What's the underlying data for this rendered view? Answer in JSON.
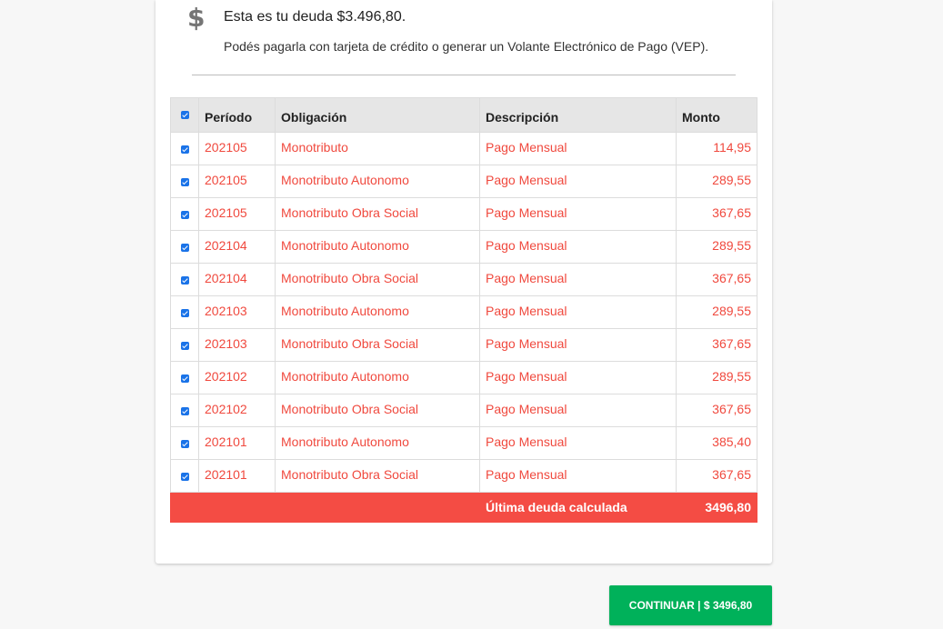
{
  "header": {
    "icon": "dollar-icon",
    "icon_glyph": "$",
    "title": "Esta es tu deuda $3.496,80.",
    "subtitle": "Podés pagarla con tarjeta de crédito o generar un Volante Electrónico de Pago (VEP)."
  },
  "table": {
    "columns": [
      "Período",
      "Obligación",
      "Descripción",
      "Monto"
    ],
    "select_all_checked": true,
    "rows": [
      {
        "checked": true,
        "period": "202105",
        "obligation": "Monotributo",
        "description": "Pago Mensual",
        "amount": "114,95"
      },
      {
        "checked": true,
        "period": "202105",
        "obligation": "Monotributo Autonomo",
        "description": "Pago Mensual",
        "amount": "289,55"
      },
      {
        "checked": true,
        "period": "202105",
        "obligation": "Monotributo Obra Social",
        "description": "Pago Mensual",
        "amount": "367,65"
      },
      {
        "checked": true,
        "period": "202104",
        "obligation": "Monotributo Autonomo",
        "description": "Pago Mensual",
        "amount": "289,55"
      },
      {
        "checked": true,
        "period": "202104",
        "obligation": "Monotributo Obra Social",
        "description": "Pago Mensual",
        "amount": "367,65"
      },
      {
        "checked": true,
        "period": "202103",
        "obligation": "Monotributo Autonomo",
        "description": "Pago Mensual",
        "amount": "289,55"
      },
      {
        "checked": true,
        "period": "202103",
        "obligation": "Monotributo Obra Social",
        "description": "Pago Mensual",
        "amount": "367,65"
      },
      {
        "checked": true,
        "period": "202102",
        "obligation": "Monotributo Autonomo",
        "description": "Pago Mensual",
        "amount": "289,55"
      },
      {
        "checked": true,
        "period": "202102",
        "obligation": "Monotributo Obra Social",
        "description": "Pago Mensual",
        "amount": "367,65"
      },
      {
        "checked": true,
        "period": "202101",
        "obligation": "Monotributo Autonomo",
        "description": "Pago Mensual",
        "amount": "385,40"
      },
      {
        "checked": true,
        "period": "202101",
        "obligation": "Monotributo Obra Social",
        "description": "Pago Mensual",
        "amount": "367,65"
      }
    ],
    "total_label": "Última deuda calculada",
    "total_amount": "3496,80"
  },
  "actions": {
    "continue_label": "CONTINUAR | $ 3496,80"
  },
  "colors": {
    "accent_red": "#f0493e",
    "total_row_bg": "#f44c44",
    "continue_green": "#00b15a",
    "checkbox_blue": "#1a73e8"
  }
}
